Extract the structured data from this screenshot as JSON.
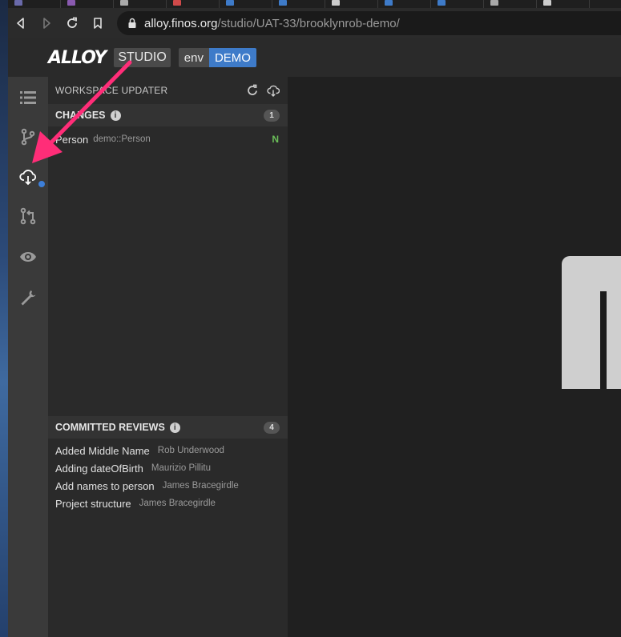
{
  "browser": {
    "url_host": "alloy.finos.org",
    "url_path": "/studio/UAT-33/brooklynrob-demo/",
    "tab_colors": [
      "#6a6aaa",
      "#8a5ab0",
      "#aaaaaa",
      "#d04a4a",
      "#3e7bc9",
      "#3e7bc9",
      "#cccccc",
      "#3e7bc9",
      "#3e7bc9",
      "#aaaaaa",
      "#cccccc"
    ]
  },
  "app": {
    "logo": "ALLOY",
    "product": "STUDIO",
    "env_key": "env",
    "env_value": "DEMO"
  },
  "activity_bar": {
    "icons": [
      "list-icon",
      "branch-icon",
      "cloud-download-icon",
      "pull-request-icon",
      "eye-icon",
      "wrench-icon"
    ]
  },
  "panel": {
    "title": "WORKSPACE UPDATER",
    "changes": {
      "label": "CHANGES",
      "count": "1",
      "items": [
        {
          "name": "Person",
          "path": "demo::Person",
          "status": "N"
        }
      ]
    },
    "reviews": {
      "label": "COMMITTED REVIEWS",
      "count": "4",
      "items": [
        {
          "title": "Added Middle Name",
          "author": "Rob Underwood"
        },
        {
          "title": "Adding dateOfBirth",
          "author": "Maurizio Pillitu"
        },
        {
          "title": "Add names to person",
          "author": "James Bracegirdle"
        },
        {
          "title": "Project structure",
          "author": "James Bracegirdle"
        }
      ]
    }
  },
  "colors": {
    "accent": "#3e7bc9",
    "annotation_arrow": "#ff2d78",
    "status_new": "#6bbf59"
  }
}
